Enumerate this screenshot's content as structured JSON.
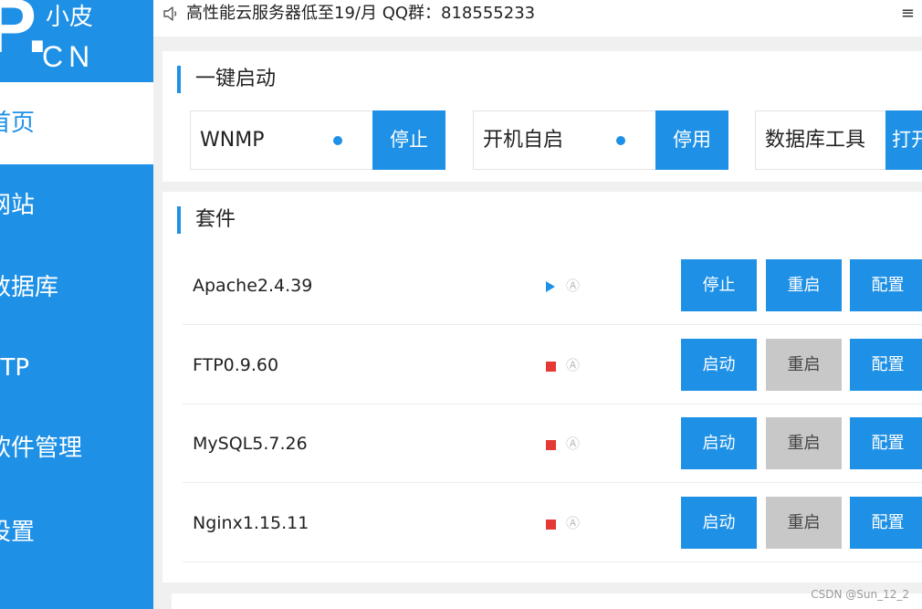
{
  "sidebar": {
    "logo": {
      "mark": "P.",
      "name": "小皮",
      "domain": "CN"
    },
    "items": [
      {
        "label": "首页",
        "active": true
      },
      {
        "label": "网站"
      },
      {
        "label": "数据库"
      },
      {
        "label": "FTP"
      },
      {
        "label": "软件管理"
      },
      {
        "label": "设置"
      }
    ]
  },
  "topbar": {
    "notice": "高性能云服务器低至19/月  QQ群：818555233",
    "menu_icon": "≡"
  },
  "quick_start": {
    "title": "一键启动",
    "tiles": [
      {
        "label": "WNMP",
        "button": "停止"
      },
      {
        "label": "开机自启",
        "button": "停用"
      },
      {
        "label": "数据库工具",
        "button": "打开"
      }
    ]
  },
  "suite": {
    "title": "套件",
    "rows": [
      {
        "name": "Apache2.4.39",
        "status": "running",
        "auto_icon": "Ⓐ",
        "buttons": [
          "停止",
          "重启",
          "配置"
        ]
      },
      {
        "name": "FTP0.9.60",
        "status": "stopped",
        "auto_icon": "Ⓐ",
        "buttons": [
          "启动",
          "重启",
          "配置"
        ]
      },
      {
        "name": "MySQL5.7.26",
        "status": "stopped",
        "auto_icon": "Ⓐ",
        "buttons": [
          "启动",
          "重启",
          "配置"
        ]
      },
      {
        "name": "Nginx1.15.11",
        "status": "stopped",
        "auto_icon": "Ⓐ",
        "buttons": [
          "启动",
          "重启",
          "配置"
        ]
      }
    ]
  },
  "watermark": "CSDN @Sun_12_2",
  "colors": {
    "accent": "#1e90e6",
    "stopped": "#e53935",
    "disabled": "#c8c8c8"
  }
}
